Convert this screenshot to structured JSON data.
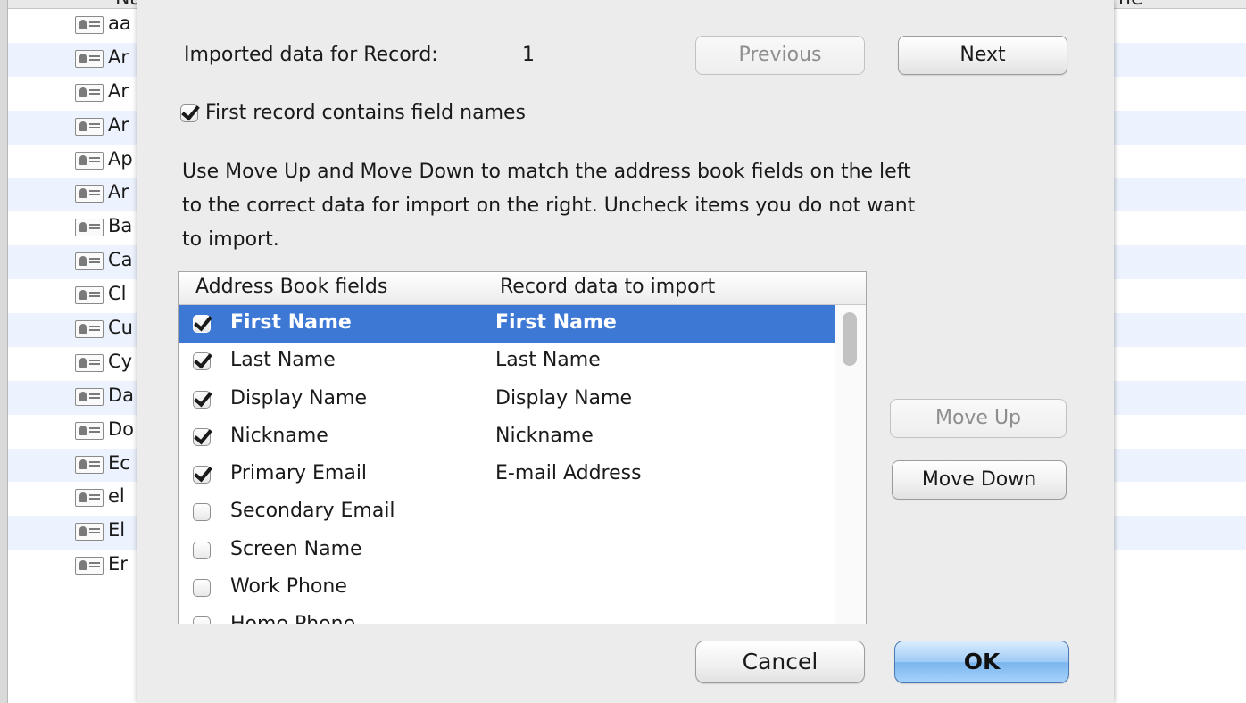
{
  "background_window": {
    "column_header_left": "Na",
    "column_header_right": "ne",
    "contacts": [
      "aa",
      "Ar",
      "Ar",
      "Ar",
      "Ap",
      "Ar",
      "Ba",
      "Ca",
      "Cl",
      "Cu",
      "Cy",
      "Da",
      "Do",
      "Ec",
      "el",
      "El",
      "Er"
    ]
  },
  "dialog": {
    "record_label": "Imported data for Record:",
    "record_number": "1",
    "previous_button": "Previous",
    "next_button": "Next",
    "first_record_checkbox_label": "First record contains field names",
    "first_record_checked": true,
    "instructions_line1": "Use Move Up and Move Down to match the address book fields on the left",
    "instructions_line2": "to the correct data for import on the right. Uncheck items you do not want",
    "instructions_line3": "to import.",
    "table": {
      "col_fields": "Address Book fields",
      "col_data": "Record data to import",
      "rows": [
        {
          "field": "First Name",
          "data": "First Name",
          "checked": true,
          "selected": true
        },
        {
          "field": "Last Name",
          "data": "Last Name",
          "checked": true,
          "selected": false
        },
        {
          "field": "Display Name",
          "data": "Display Name",
          "checked": true,
          "selected": false
        },
        {
          "field": "Nickname",
          "data": "Nickname",
          "checked": true,
          "selected": false
        },
        {
          "field": "Primary Email",
          "data": "E-mail Address",
          "checked": true,
          "selected": false
        },
        {
          "field": "Secondary Email",
          "data": "",
          "checked": false,
          "selected": false
        },
        {
          "field": "Screen Name",
          "data": "",
          "checked": false,
          "selected": false
        },
        {
          "field": "Work Phone",
          "data": "",
          "checked": false,
          "selected": false
        },
        {
          "field": "Home Phone",
          "data": "",
          "checked": false,
          "selected": false
        }
      ]
    },
    "move_up_button": "Move Up",
    "move_down_button": "Move Down",
    "cancel_button": "Cancel",
    "ok_button": "OK"
  }
}
